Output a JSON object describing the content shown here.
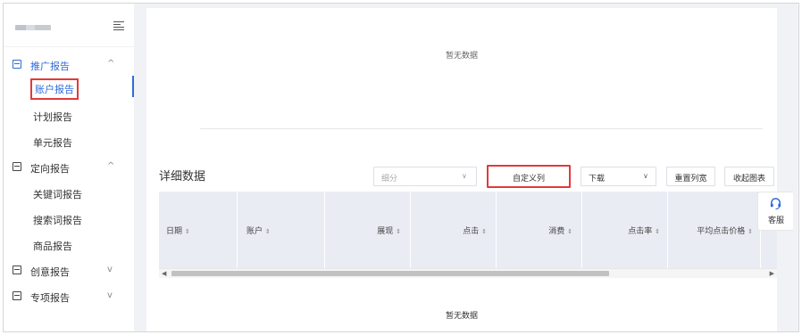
{
  "sidebar": {
    "groups": [
      {
        "label": "推广报告",
        "expanded": true,
        "chevron": "^"
      },
      {
        "label": "定向报告",
        "expanded": true,
        "chevron": "^"
      },
      {
        "label": "创意报告",
        "expanded": false,
        "chevron": "v"
      },
      {
        "label": "专项报告",
        "expanded": false,
        "chevron": "v"
      }
    ],
    "promo_items": [
      "账户报告",
      "计划报告",
      "单元报告"
    ],
    "target_items": [
      "关键词报告",
      "搜索词报告",
      "商品报告"
    ],
    "active_item": "账户报告"
  },
  "main": {
    "empty_top": "暂无数据",
    "detail_title": "详细数据",
    "segment_placeholder": "细分",
    "custom_columns": "自定义列",
    "download": "下载",
    "reset_width": "重置列宽",
    "collapse_chart": "收起图表",
    "columns": [
      "日期",
      "账户",
      "展现",
      "点击",
      "消费",
      "点击率",
      "平均点击价格"
    ],
    "empty_bottom": "暂无数据"
  },
  "service": {
    "label": "客服"
  },
  "colors": {
    "accent": "#2f6bd8",
    "highlight": "#e23a3a",
    "header_bg": "#e9ecf3",
    "page_bg": "#f0f2f5"
  }
}
